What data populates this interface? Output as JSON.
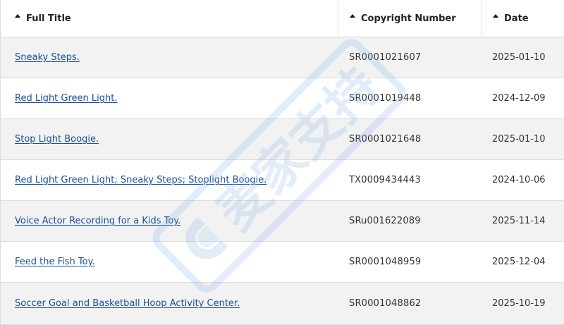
{
  "columns": {
    "title": "Full Title",
    "copyright": "Copyright Number",
    "date": "Date"
  },
  "rows": [
    {
      "title": "Sneaky Steps.",
      "copyright": "SR0001021607",
      "date": "2025-01-10"
    },
    {
      "title": "Red Light Green Light.",
      "copyright": "SR0001019448",
      "date": "2024-12-09"
    },
    {
      "title": "Stop Light Boogie.",
      "copyright": "SR0001021648",
      "date": "2025-01-10"
    },
    {
      "title": "Red Light Green Light; Sneaky Steps; Stoplight Boogie.",
      "copyright": "TX0009434443",
      "date": "2024-10-06"
    },
    {
      "title": "Voice Actor Recording for a Kids Toy.",
      "copyright": "SRu001622089",
      "date": "2025-11-14"
    },
    {
      "title": "Feed the Fish Toy.",
      "copyright": "SR0001048959",
      "date": "2025-12-04"
    },
    {
      "title": "Soccer Goal and Basketball Hoop Activity Center.",
      "copyright": "SR0001048862",
      "date": "2025-10-19"
    }
  ],
  "watermark": {
    "text": "麦家支持",
    "color": "#7fb2e5"
  },
  "colors": {
    "link": "#1a4f99",
    "stripe": "#f2f2f2"
  }
}
